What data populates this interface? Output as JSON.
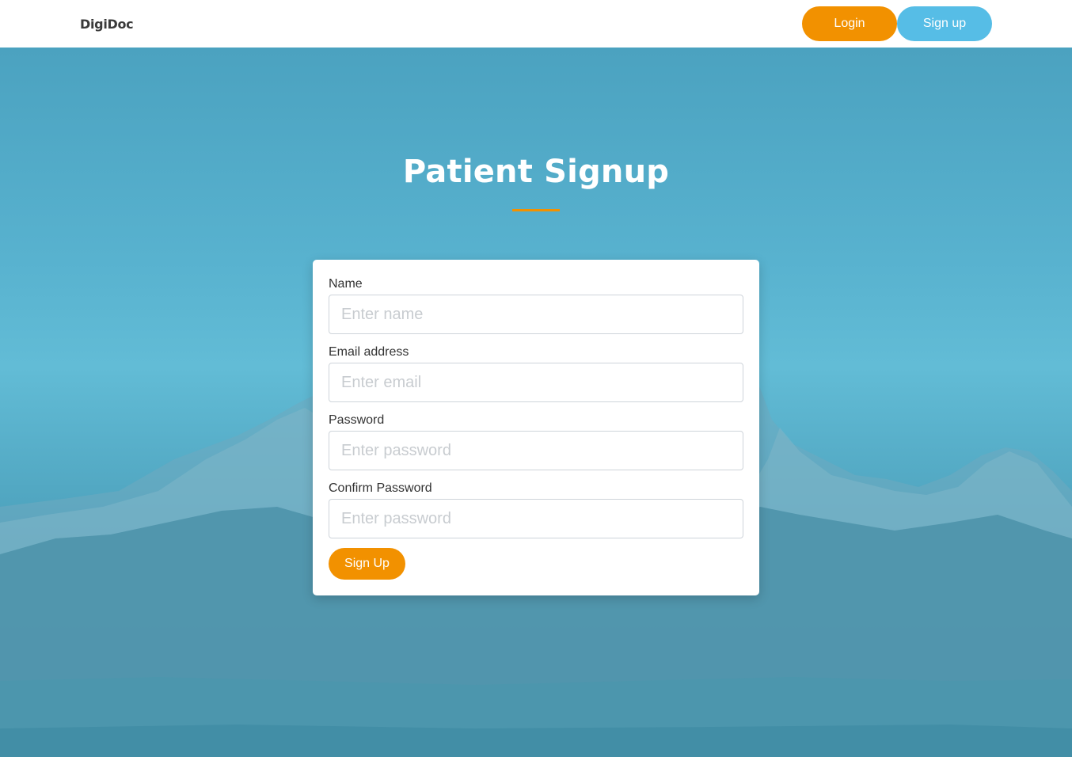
{
  "navbar": {
    "brand": "DigiDoc",
    "login_label": "Login",
    "signup_label": "Sign up"
  },
  "page": {
    "title": "Patient Signup"
  },
  "form": {
    "name": {
      "label": "Name",
      "placeholder": "Enter name",
      "value": ""
    },
    "email": {
      "label": "Email address",
      "placeholder": "Enter email",
      "value": ""
    },
    "password": {
      "label": "Password",
      "placeholder": "Enter password",
      "value": ""
    },
    "confirm_password": {
      "label": "Confirm Password",
      "placeholder": "Enter password",
      "value": ""
    },
    "submit_label": "Sign Up"
  },
  "colors": {
    "accent_orange": "#f29100",
    "accent_blue": "#56bde6",
    "hero_blue": "#4aa3bf"
  }
}
